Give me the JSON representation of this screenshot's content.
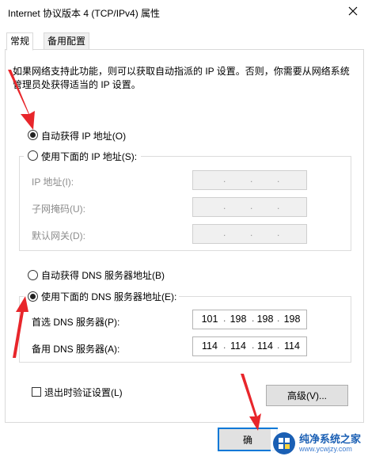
{
  "window": {
    "title": "Internet 协议版本 4 (TCP/IPv4) 属性"
  },
  "tabs": [
    {
      "label": "常规",
      "active": true
    },
    {
      "label": "备用配置",
      "active": false
    }
  ],
  "description": "如果网络支持此功能，则可以获取自动指派的 IP 设置。否则，你需要从网络系统管理员处获得适当的 IP 设置。",
  "ip": {
    "auto_label": "自动获得 IP 地址(O)",
    "auto_selected": true,
    "manual_label": "使用下面的 IP 地址(S):",
    "manual_selected": false,
    "address_label": "IP 地址(I):",
    "subnet_label": "子网掩码(U):",
    "gateway_label": "默认网关(D):"
  },
  "dns": {
    "auto_label": "自动获得 DNS 服务器地址(B)",
    "auto_selected": false,
    "manual_label": "使用下面的 DNS 服务器地址(E):",
    "manual_selected": true,
    "preferred_label": "首选 DNS 服务器(P):",
    "preferred_value": [
      "101",
      "198",
      "198",
      "198"
    ],
    "alternate_label": "备用 DNS 服务器(A):",
    "alternate_value": [
      "114",
      "114",
      "114",
      "114"
    ]
  },
  "validate_label": "退出时验证设置(L)",
  "validate_checked": false,
  "advanced_label": "高级(V)...",
  "ok_label": "确",
  "watermark": {
    "title": "纯净系统之家",
    "url": "www.ycwjzy.com"
  },
  "colors": {
    "arrow": "#e8262b",
    "watermark_blue": "#1a5fb4"
  }
}
